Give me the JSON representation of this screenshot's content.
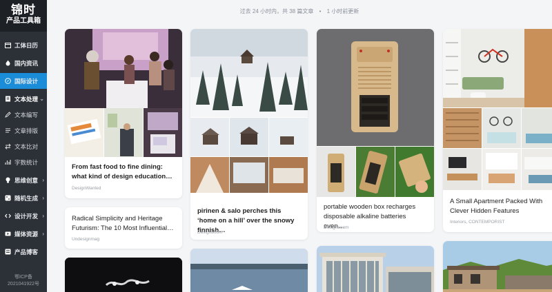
{
  "sidebar": {
    "logo_line1": "锦时",
    "logo_line2": "产品工具箱",
    "items": [
      {
        "label": "工体日历",
        "icon": "calendar-icon"
      },
      {
        "label": "国内资讯",
        "icon": "fire-icon"
      },
      {
        "label": "国际设计",
        "icon": "compass-icon"
      },
      {
        "label": "文本处理",
        "icon": "text-icon"
      },
      {
        "label": "文本编写",
        "icon": "pen-icon"
      },
      {
        "label": "文章排版",
        "icon": "layout-icon"
      },
      {
        "label": "文本比对",
        "icon": "compare-icon"
      },
      {
        "label": "字数统计",
        "icon": "count-icon"
      },
      {
        "label": "思维创意",
        "icon": "bulb-icon"
      },
      {
        "label": "随机生成",
        "icon": "dice-icon"
      },
      {
        "label": "设计开发",
        "icon": "code-icon"
      },
      {
        "label": "媒体资源",
        "icon": "media-icon"
      },
      {
        "label": "产品博客",
        "icon": "blog-icon"
      }
    ],
    "icp_line1": "鄂ICP备",
    "icp_line2": "2021041922号"
  },
  "status": {
    "text": "过去 24 小时内，共 38 篇文章",
    "dot": "•",
    "updated": "1 小时前更新"
  },
  "cards": [
    {
      "title": "From fast food to fine dining: what kind of design education…",
      "source": "DesignWanted"
    },
    {
      "title": "Radical Simplicity and Heritage Futurism: The 10 Most Influential…",
      "source": "Undesignmag"
    },
    {
      "title": "pirinen & salo perches this ‘home on a hill’ over the snowy finnish…",
      "source": "Designboom"
    },
    {
      "title": "portable wooden box recharges disposable alkaline batteries even…",
      "source": "Designboom"
    },
    {
      "title": "A Small Apartment Packed With Clever Hidden Features",
      "source": "Interiors, CONTEMPORIST"
    }
  ],
  "colors": {
    "accent": "#1a8cd8",
    "sidebar": "#2c3138"
  }
}
